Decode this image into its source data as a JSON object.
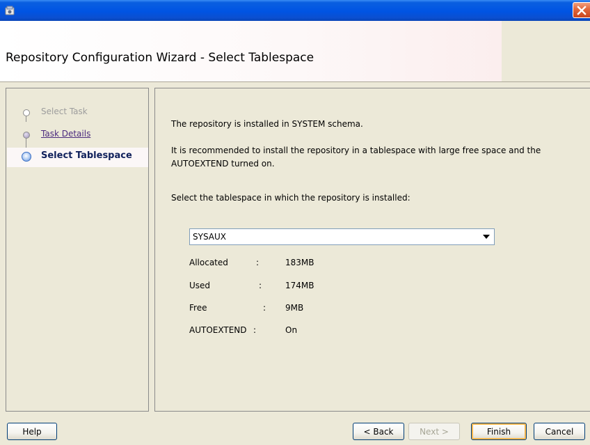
{
  "window": {
    "title_icon": "oracle-app-icon",
    "close_icon": "close-icon",
    "title_color": "#0054e3",
    "close_color": "#e26a3f"
  },
  "header": {
    "title": "Repository Configuration Wizard - Select Tablespace"
  },
  "steps": [
    {
      "label": "Select Task",
      "state": "disabled"
    },
    {
      "label": "Task Details",
      "state": "visited"
    },
    {
      "label": "Select Tablespace",
      "state": "current"
    }
  ],
  "content": {
    "intro": "The repository is installed in SYSTEM schema.",
    "recommend_line1": "It is recommended to install the repository in a tablespace with large free space and the",
    "recommend_line2": "AUTOEXTEND turned on.",
    "select_prompt": "Select the tablespace in which the repository is installed:",
    "tablespace_selected": "SYSAUX",
    "stats": [
      {
        "label": "Allocated",
        "sep": ":",
        "value": "183MB"
      },
      {
        "label": "Used",
        "sep": ":",
        "value": "174MB"
      },
      {
        "label": "Free",
        "sep": ":",
        "value": "9MB"
      },
      {
        "label": "AUTOEXTEND",
        "sep": ":",
        "value": "On"
      }
    ]
  },
  "buttons": {
    "help": "Help",
    "back": "< Back",
    "next": "Next >",
    "finish": "Finish",
    "cancel": "Cancel"
  }
}
